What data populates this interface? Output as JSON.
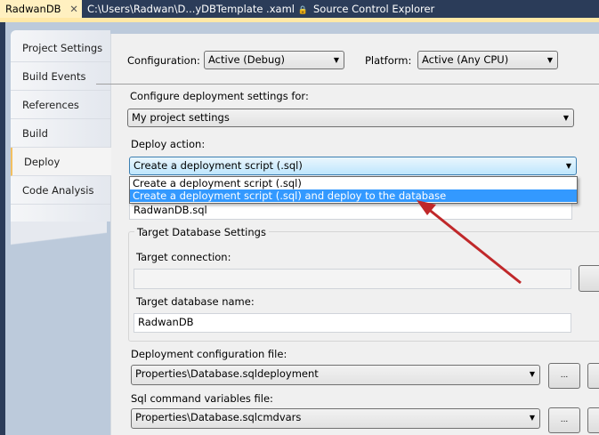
{
  "doc_tabs": [
    {
      "label": "RadwanDB",
      "active": true
    },
    {
      "label": "C:\\Users\\Radwan\\D...yDBTemplate .xaml"
    },
    {
      "label": "Source Control Explorer"
    }
  ],
  "sidebar": {
    "items": [
      {
        "label": "Project Settings"
      },
      {
        "label": "Build Events"
      },
      {
        "label": "References"
      },
      {
        "label": "Build"
      },
      {
        "label": "Deploy",
        "selected": true
      },
      {
        "label": "Code Analysis"
      }
    ]
  },
  "main": {
    "configuration_label": "Configuration:",
    "configuration_value": "Active (Debug)",
    "platform_label": "Platform:",
    "platform_value": "Active (Any CPU)",
    "configure_for_label": "Configure deployment settings for:",
    "configure_for_value": "My project settings",
    "deploy_action_label": "Deploy action:",
    "deploy_action_value": "Create a deployment script (.sql)",
    "deploy_action_options": [
      "Create a deployment script (.sql)",
      "Create a deployment script (.sql) and deploy to the database"
    ],
    "script_file_value": "RadwanDB.sql",
    "target_group_title": "Target Database Settings",
    "target_connection_label": "Target connection:",
    "target_connection_value": "",
    "target_db_label": "Target database name:",
    "target_db_value": "RadwanDB",
    "deploy_config_label": "Deployment configuration file:",
    "deploy_config_value": "Properties\\Database.sqldeployment",
    "sqlcmd_label": "Sql command variables file:",
    "sqlcmd_value": "Properties\\Database.sqlcmdvars",
    "browse_label": "..."
  },
  "colors": {
    "accent_highlight": "#3399ff",
    "arrow": "#c0282a",
    "tab_active": "#ffe8a6"
  }
}
